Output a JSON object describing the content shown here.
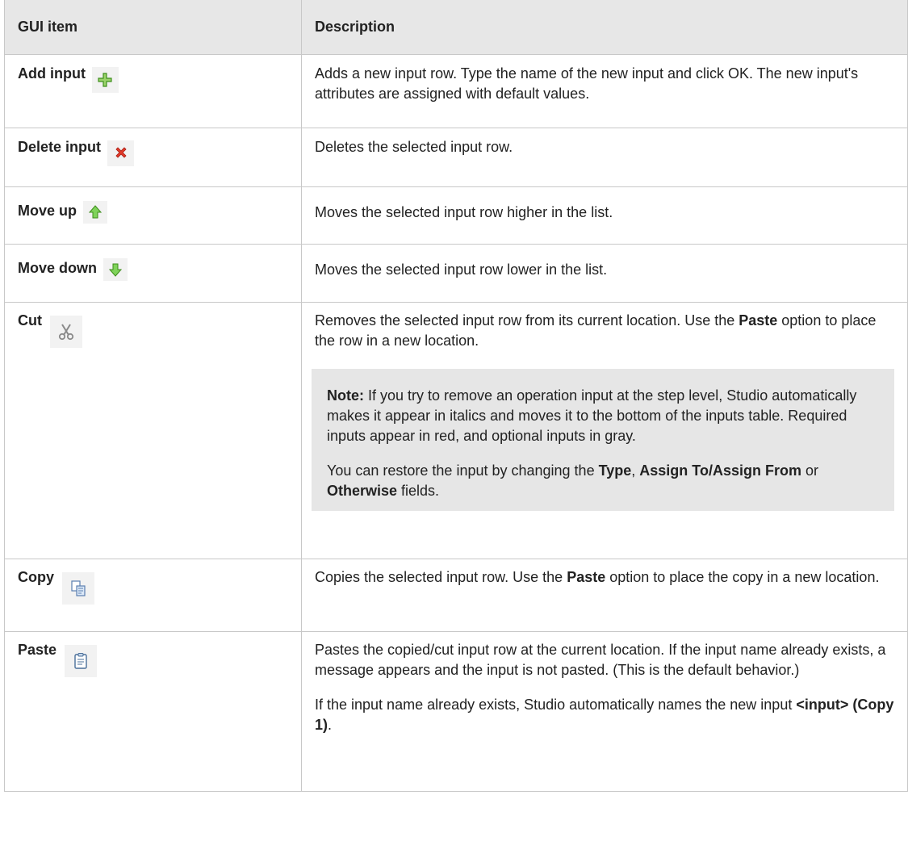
{
  "header": {
    "col1": "GUI item",
    "col2": "Description"
  },
  "rows": [
    {
      "item": "Add input",
      "icon": "plus-icon",
      "desc": "Adds a new input row. Type the name of the new input and click OK. The new input's attributes are assigned with default values."
    },
    {
      "item": "Delete input",
      "icon": "delete-x-icon",
      "desc": "Deletes the selected input row."
    },
    {
      "item": "Move up",
      "icon": "arrow-up-icon",
      "desc": "Moves the selected input row higher in the list."
    },
    {
      "item": "Move down",
      "icon": "arrow-down-icon",
      "desc": "Moves the selected input row lower in the list."
    },
    {
      "item": "Cut",
      "icon": "scissors-icon",
      "desc_a": "Removes the selected input row from its current location. Use the ",
      "desc_b": "Paste",
      "desc_c": " option to place the row in a new location.",
      "note_label": "Note:",
      "note_text": " If you try to remove an operation input at the step level, Studio automatically makes it appear in italics and moves it to the bottom of the inputs table. Required inputs appear in red, and optional inputs in gray.",
      "note2_a": "You can restore the input by changing the ",
      "note2_b": "Type",
      "note2_c": ", ",
      "note2_d": "Assign To/Assign From",
      "note2_e": " or ",
      "note2_f": "Otherwise",
      "note2_g": " fields."
    },
    {
      "item": "Copy",
      "icon": "copy-icon",
      "desc_a": "Copies the selected input row. Use the ",
      "desc_b": "Paste",
      "desc_c": " option to place the copy in a new location."
    },
    {
      "item": "Paste",
      "icon": "clipboard-icon",
      "desc": "Pastes the copied/cut input row at the current location. If the input name already exists, a message appears and the input is not pasted. (This is the default behavior.)",
      "desc2_a": "If the input name already exists, Studio automatically names the new input ",
      "desc2_b": "<input> (Copy 1)",
      "desc2_c": "."
    }
  ]
}
